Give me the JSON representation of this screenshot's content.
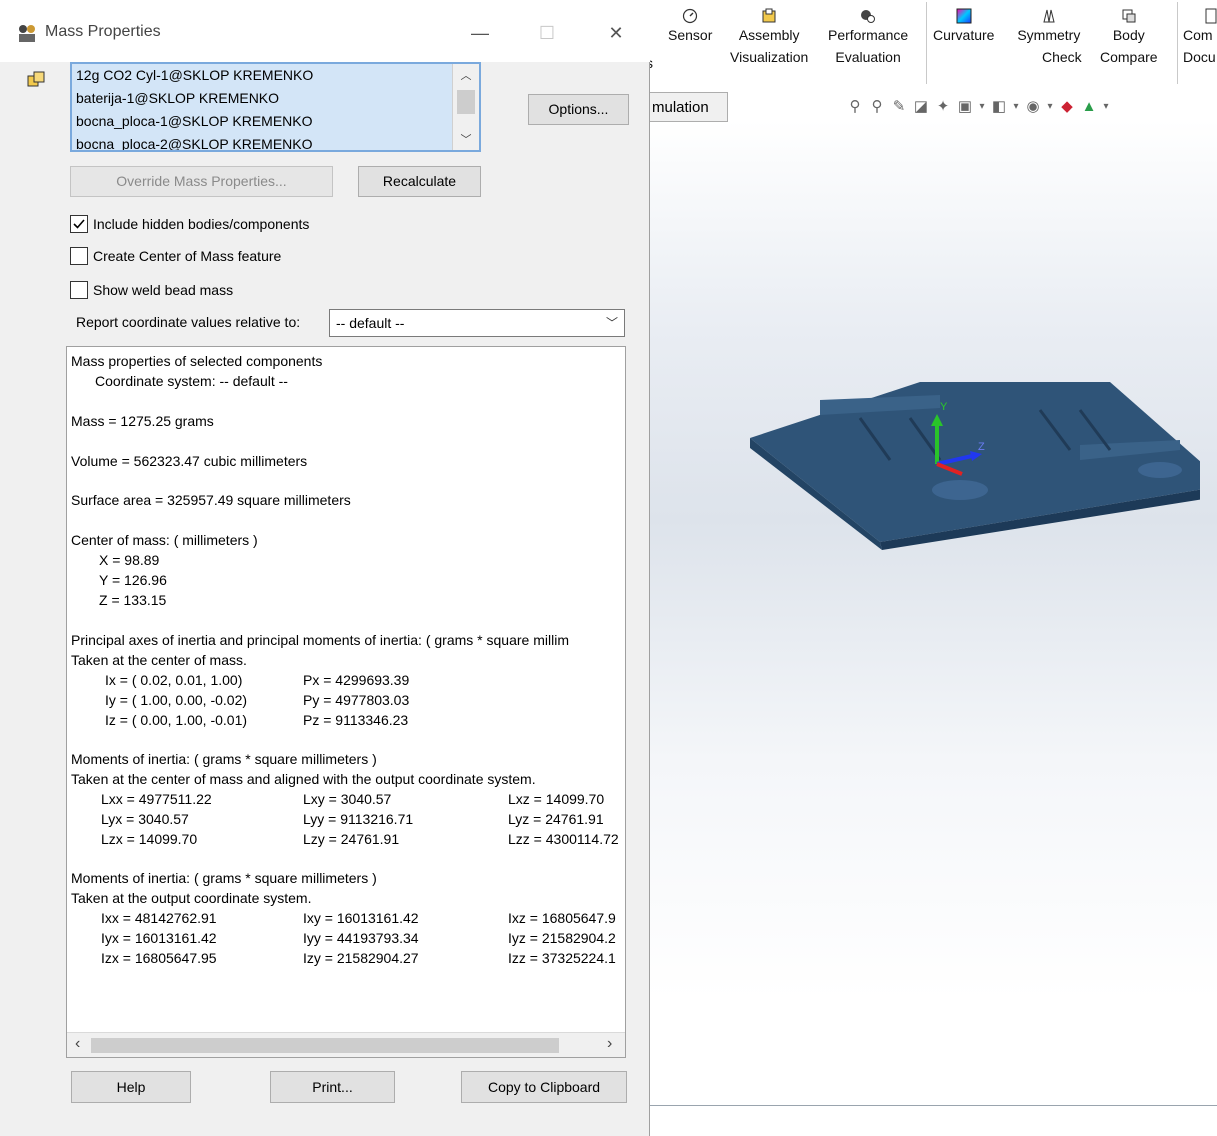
{
  "cad": {
    "ribbon": [
      {
        "line1": "Sensor",
        "line2": "",
        "icon": "dial-icon"
      },
      {
        "line1": "Assembly",
        "line2": "Visualization",
        "icon": "assembly-icon"
      },
      {
        "line1": "Performance",
        "line2": "Evaluation",
        "icon": "performance-icon"
      },
      {
        "line1": "Curvature",
        "line2": "",
        "icon": "curvature-icon"
      },
      {
        "line1": "Symmetry",
        "line2": "Check",
        "icon": "symmetry-icon"
      },
      {
        "line1": "Body",
        "line2": "Compare",
        "icon": "body-compare-icon"
      },
      {
        "line1": "Com",
        "line2": "Docu",
        "icon": "compare-docs-icon"
      }
    ],
    "ribbon_cut_letter": "s",
    "simulation_tab": "mulation",
    "triad": {
      "x": "Z",
      "y": "Y"
    }
  },
  "dialog": {
    "title": "Mass Properties",
    "window_buttons": {
      "minimize": "—",
      "maximize": "☐",
      "close": "✕"
    },
    "components": [
      "12g CO2 Cyl-1@SKLOP KREMENKO",
      "baterija-1@SKLOP KREMENKO",
      "bocna_ploca-1@SKLOP KREMENKO",
      "bocna_ploca-2@SKLOP KREMENKO"
    ],
    "buttons": {
      "options": "Options...",
      "override": "Override Mass Properties...",
      "recalculate": "Recalculate",
      "help": "Help",
      "print": "Print...",
      "copy": "Copy to Clipboard"
    },
    "checkboxes": [
      {
        "label": "Include hidden bodies/components",
        "checked": true
      },
      {
        "label": "Create Center of Mass feature",
        "checked": false
      },
      {
        "label": "Show weld bead mass",
        "checked": false
      }
    ],
    "coord_label": "Report coordinate values relative to:",
    "coord_value": "-- default --",
    "report": {
      "header": "Mass properties of selected components",
      "coord_sys": "Coordinate system: -- default --",
      "mass": "Mass = 1275.25 grams",
      "volume": "Volume = 562323.47 cubic millimeters",
      "surface": "Surface area = 325957.49  square millimeters",
      "com_title": "Center of mass: ( millimeters )",
      "com": [
        "X = 98.89",
        "Y = 126.96",
        "Z = 133.15"
      ],
      "principal_title": "Principal axes of inertia and principal moments of inertia: ( grams *  square millim",
      "principal_sub": "Taken at the center of mass.",
      "principal_rows": [
        [
          "Ix = ( 0.02,  0.01,  1.00)",
          "Px = 4299693.39"
        ],
        [
          "Iy = ( 1.00,  0.00, -0.02)",
          "Py = 4977803.03"
        ],
        [
          "Iz = ( 0.00,  1.00, -0.01)",
          "Pz = 9113346.23"
        ]
      ],
      "moi1_title": "Moments of inertia: ( grams *  square millimeters )",
      "moi1_sub": "Taken at the center of mass and aligned with the output coordinate system.",
      "moi1_rows": [
        [
          "Lxx = 4977511.22",
          "Lxy = 3040.57",
          "Lxz = 14099.70"
        ],
        [
          "Lyx = 3040.57",
          "Lyy = 9113216.71",
          "Lyz = 24761.91"
        ],
        [
          "Lzx = 14099.70",
          "Lzy = 24761.91",
          "Lzz = 4300114.72"
        ]
      ],
      "moi2_title": "Moments of inertia: ( grams *  square millimeters )",
      "moi2_sub": "Taken at the output coordinate system.",
      "moi2_rows": [
        [
          "Ixx = 48142762.91",
          "Ixy = 16013161.42",
          "Ixz = 16805647.9"
        ],
        [
          "Iyx = 16013161.42",
          "Iyy = 44193793.34",
          "Iyz = 21582904.2"
        ],
        [
          "Izx = 16805647.95",
          "Izy = 21582904.27",
          "Izz = 37325224.1"
        ]
      ]
    }
  }
}
